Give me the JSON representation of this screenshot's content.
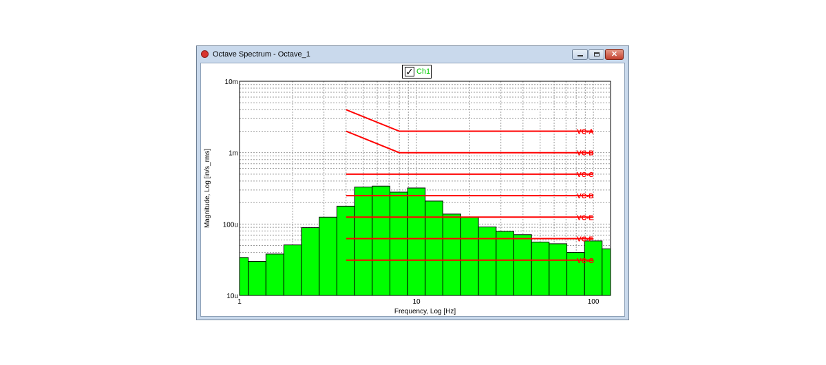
{
  "window": {
    "title": "Octave Spectrum - Octave_1",
    "icon": "app-icon",
    "controls": {
      "minimize": "minimize-icon",
      "maximize": "maximize-icon",
      "close": "close-icon",
      "close_glyph": "✕"
    }
  },
  "legend": {
    "label": "Ch1",
    "checked": true,
    "check_glyph": "✓",
    "color": "#00cc00"
  },
  "chart_data": {
    "type": "bar",
    "title": "",
    "xlabel": "Frequency, Log [Hz]",
    "ylabel": "Magnitude, Log [in/s_rms]",
    "x_scale": "log",
    "y_scale": "log",
    "xlim": [
      1,
      125
    ],
    "ylim": [
      1e-05,
      0.01
    ],
    "x_ticks": [
      {
        "value": 1,
        "label": "1"
      },
      {
        "value": 10,
        "label": "10"
      },
      {
        "value": 100,
        "label": "100"
      }
    ],
    "y_ticks": [
      {
        "value": 1e-05,
        "label": "10u"
      },
      {
        "value": 0.0001,
        "label": "100u"
      },
      {
        "value": 0.001,
        "label": "1m"
      },
      {
        "value": 0.01,
        "label": "10m"
      }
    ],
    "grid": true,
    "bar_color": "#00ff00",
    "bars": [
      {
        "x0": 1.0,
        "x1": 1.12,
        "value": 3.4e-05
      },
      {
        "x0": 1.12,
        "x1": 1.41,
        "value": 3e-05
      },
      {
        "x0": 1.41,
        "x1": 1.78,
        "value": 3.8e-05
      },
      {
        "x0": 1.78,
        "x1": 2.24,
        "value": 5.1e-05
      },
      {
        "x0": 2.24,
        "x1": 2.82,
        "value": 8.9e-05
      },
      {
        "x0": 2.82,
        "x1": 3.55,
        "value": 0.000125
      },
      {
        "x0": 3.55,
        "x1": 4.47,
        "value": 0.000178
      },
      {
        "x0": 4.47,
        "x1": 5.62,
        "value": 0.00033
      },
      {
        "x0": 5.62,
        "x1": 7.08,
        "value": 0.00034
      },
      {
        "x0": 7.08,
        "x1": 8.91,
        "value": 0.00028
      },
      {
        "x0": 8.91,
        "x1": 11.2,
        "value": 0.00032
      },
      {
        "x0": 11.2,
        "x1": 14.1,
        "value": 0.00021
      },
      {
        "x0": 14.1,
        "x1": 17.8,
        "value": 0.000138
      },
      {
        "x0": 17.8,
        "x1": 22.4,
        "value": 0.000125
      },
      {
        "x0": 22.4,
        "x1": 28.2,
        "value": 9.1e-05
      },
      {
        "x0": 28.2,
        "x1": 35.5,
        "value": 7.9e-05
      },
      {
        "x0": 35.5,
        "x1": 44.7,
        "value": 7.1e-05
      },
      {
        "x0": 44.7,
        "x1": 56.2,
        "value": 5.6e-05
      },
      {
        "x0": 56.2,
        "x1": 70.8,
        "value": 5.3e-05
      },
      {
        "x0": 70.8,
        "x1": 89.1,
        "value": 4e-05
      },
      {
        "x0": 89.1,
        "x1": 112,
        "value": 5.8e-05
      },
      {
        "x0": 112,
        "x1": 125,
        "value": 4.5e-05
      }
    ],
    "criteria_lines": [
      {
        "name": "VC-A",
        "color": "#ff0000",
        "points": [
          [
            4,
            0.004
          ],
          [
            8,
            0.002
          ],
          [
            100,
            0.002
          ]
        ]
      },
      {
        "name": "VC-B",
        "color": "#ff0000",
        "points": [
          [
            4,
            0.002
          ],
          [
            8,
            0.001
          ],
          [
            100,
            0.001
          ]
        ]
      },
      {
        "name": "VC-C",
        "color": "#ff0000",
        "points": [
          [
            4,
            0.0005
          ],
          [
            100,
            0.0005
          ]
        ]
      },
      {
        "name": "VC-D",
        "color": "#ff0000",
        "points": [
          [
            4,
            0.00025
          ],
          [
            100,
            0.00025
          ]
        ]
      },
      {
        "name": "VC-E",
        "color": "#ff0000",
        "points": [
          [
            4,
            0.000125
          ],
          [
            100,
            0.000125
          ]
        ]
      },
      {
        "name": "VC-F",
        "color": "#ff0000",
        "points": [
          [
            4,
            6.25e-05
          ],
          [
            100,
            6.25e-05
          ]
        ]
      },
      {
        "name": "VC-G",
        "color": "#ff0000",
        "points": [
          [
            4,
            3.12e-05
          ],
          [
            100,
            3.12e-05
          ]
        ]
      }
    ]
  }
}
